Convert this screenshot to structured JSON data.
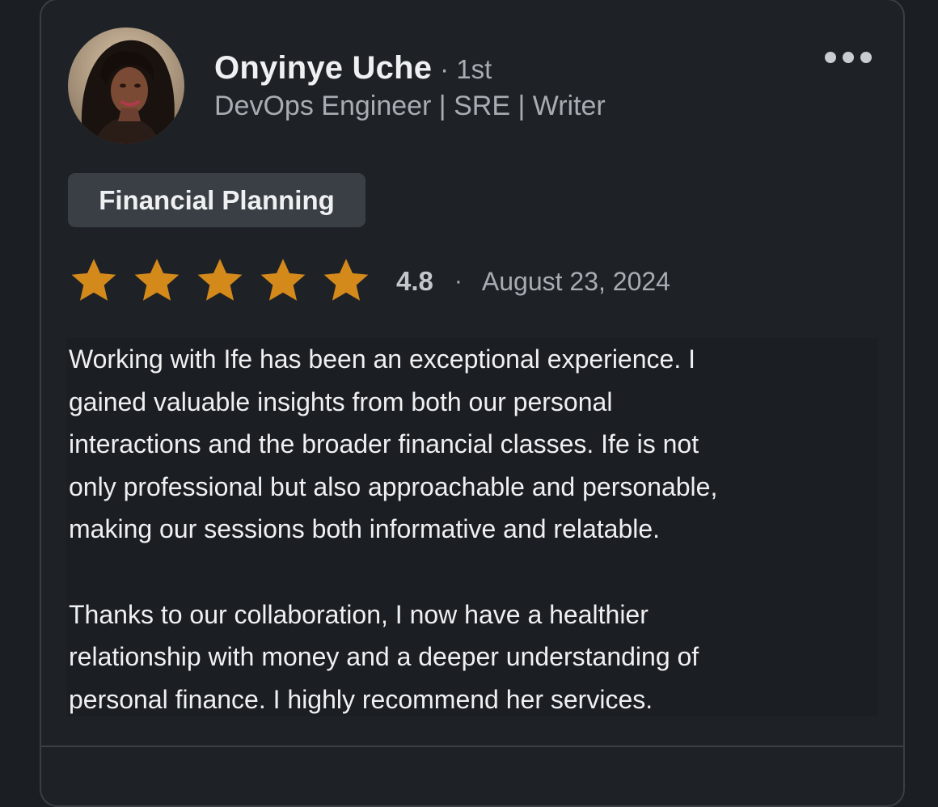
{
  "reviewer": {
    "name": "Onyinye Uche",
    "degree": "· 1st",
    "headline": "DevOps Engineer | SRE | Writer"
  },
  "menu": {
    "icon": "more-horizontal-icon"
  },
  "service_tag": "Financial Planning",
  "rating": {
    "stars_total": 5,
    "stars_filled": 5,
    "score": "4.8",
    "separator": "·",
    "date": "August 23, 2024",
    "star_color": "#d4891b"
  },
  "review": {
    "paragraph_1": "Working with Ife has been an exceptional experience. I\ngained valuable insights from both our personal\ninteractions and the broader financial classes. Ife is not\nonly professional but also approachable and personable,\nmaking our sessions both informative and relatable.",
    "paragraph_2": "Thanks to our collaboration, I now have a healthier\nrelationship with money and a deeper understanding of\npersonal finance. I highly recommend her services."
  },
  "colors": {
    "background": "#1b1f23",
    "card": "#1e2227",
    "tag_bg": "#3a3f45",
    "primary_text": "#eef0f2",
    "secondary_text": "#a7adb3"
  }
}
